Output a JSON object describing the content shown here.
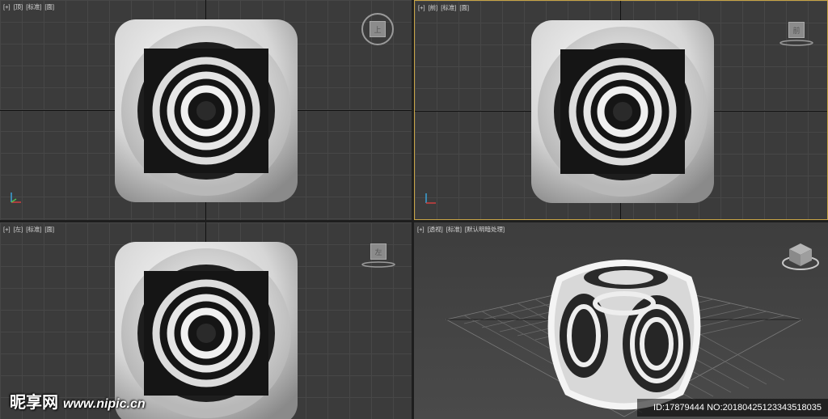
{
  "viewports": {
    "top": {
      "labels": [
        "[+]",
        "[顶]",
        "[标准]",
        "[面]"
      ],
      "navcube_label": "上"
    },
    "front": {
      "labels": [
        "[+]",
        "[前]",
        "[标准]",
        "[面]"
      ],
      "navcube_label": "前"
    },
    "left": {
      "labels": [
        "[+]",
        "[左]",
        "[标准]",
        "[面]"
      ],
      "navcube_label": "左"
    },
    "perspective": {
      "labels": [
        "[+]",
        "[透视]",
        "[标准]",
        "[默认明暗处理]"
      ]
    }
  },
  "watermark": {
    "logo": "昵享网",
    "url": "www.nipic.cn"
  },
  "image_id": "ID:17879444 NO:20180425123343518035",
  "colors": {
    "viewport_bg": "#3b3b3b",
    "grid_line": "#474747",
    "active_border": "#c8a546",
    "object": "#e0e0e0"
  }
}
